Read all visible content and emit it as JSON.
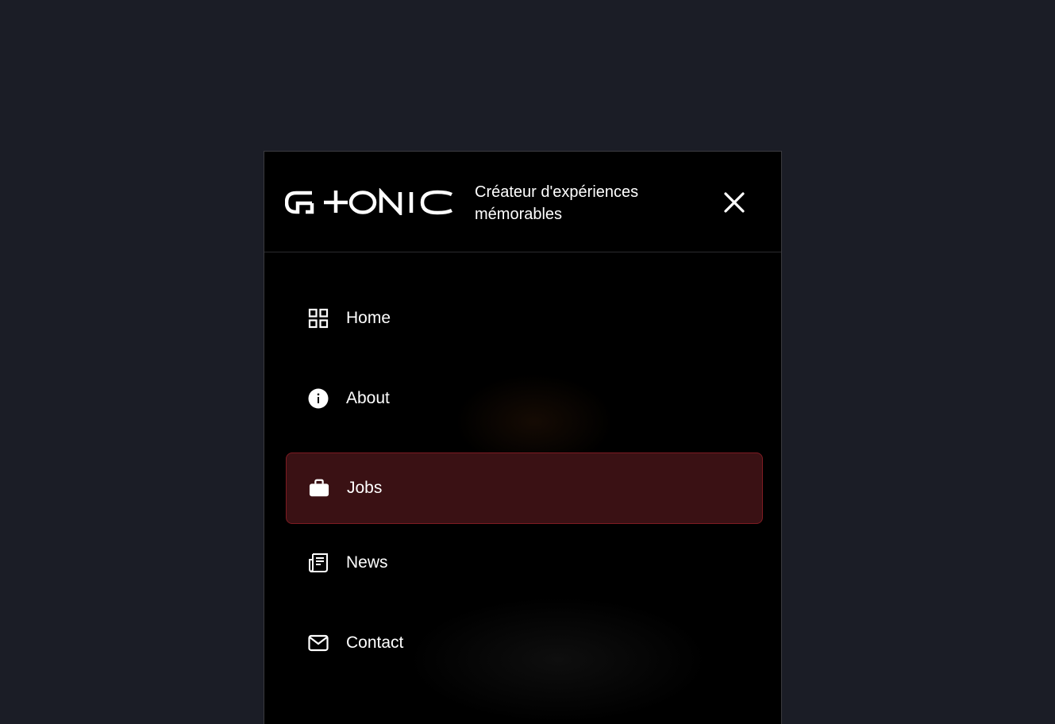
{
  "brand": {
    "logo_text": "G+ONIC",
    "tagline": "Créateur d'expériences mémorables"
  },
  "nav": {
    "items": [
      {
        "label": "Home",
        "icon": "grid-icon",
        "active": false
      },
      {
        "label": "About",
        "icon": "info-icon",
        "active": false
      },
      {
        "label": "Jobs",
        "icon": "briefcase-icon",
        "active": true
      },
      {
        "label": "News",
        "icon": "newspaper-icon",
        "active": false
      },
      {
        "label": "Contact",
        "icon": "mail-icon",
        "active": false
      }
    ]
  },
  "colors": {
    "page_bg": "#1b1d26",
    "panel_bg": "#000000",
    "active_bg": "#3a1114",
    "active_border": "#7e1b22",
    "text": "#ffffff"
  }
}
